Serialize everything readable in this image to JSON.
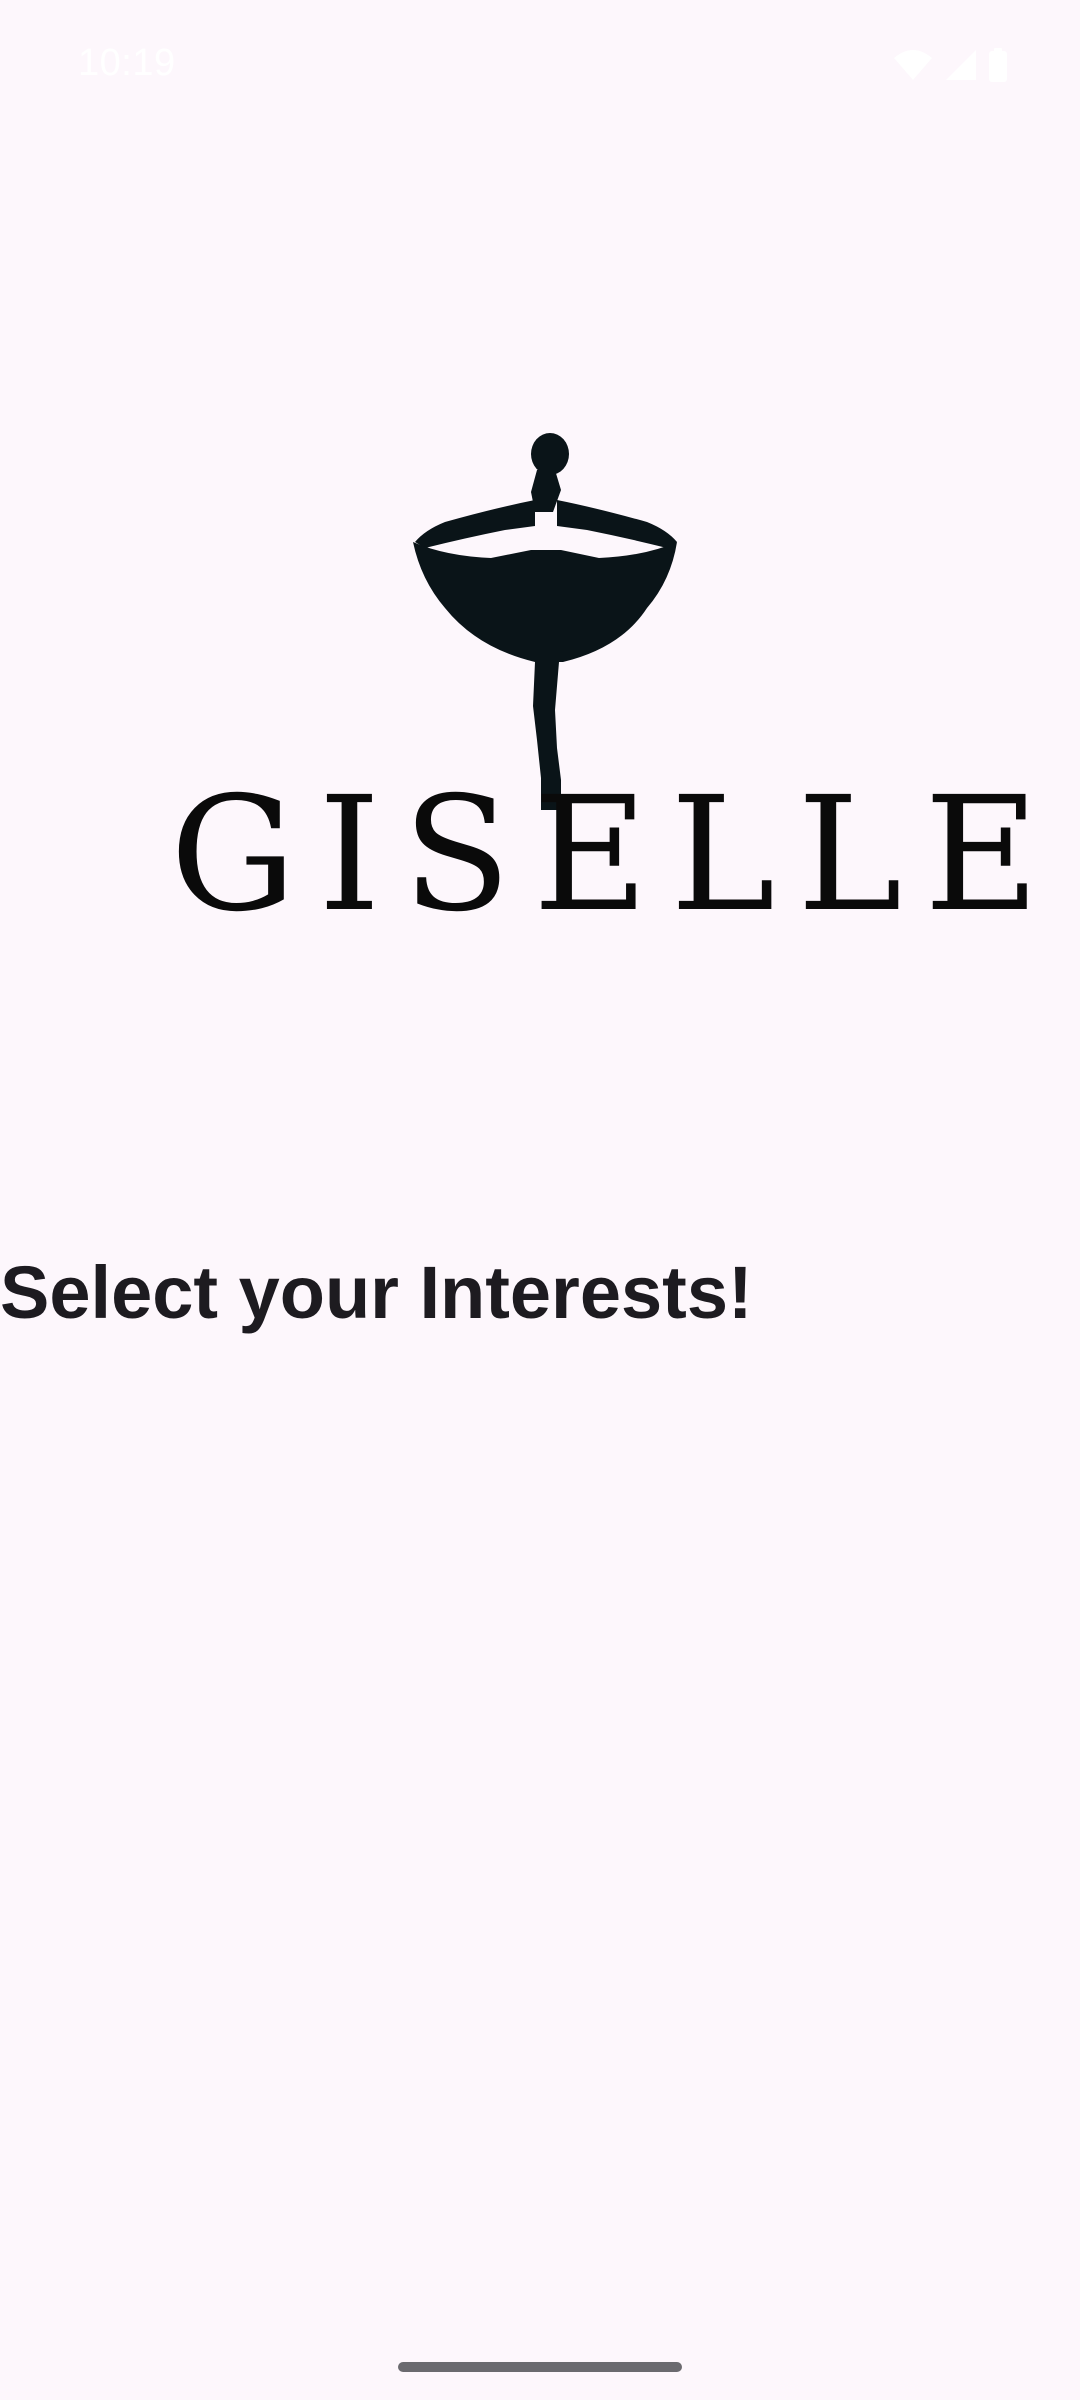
{
  "status_bar": {
    "time": "10:19",
    "icons": [
      "wifi-icon",
      "signal-icon",
      "battery-icon"
    ]
  },
  "logo": {
    "wordmark": "GISELLE",
    "figure": "ballerina-silhouette"
  },
  "main": {
    "headline": "Select your Interests!"
  },
  "colors": {
    "background": "#fdf7fc",
    "headline": "#1d1b20",
    "logo": "#0a1418",
    "status_text": "#ffffff",
    "home_indicator": "#6b6a6f"
  }
}
